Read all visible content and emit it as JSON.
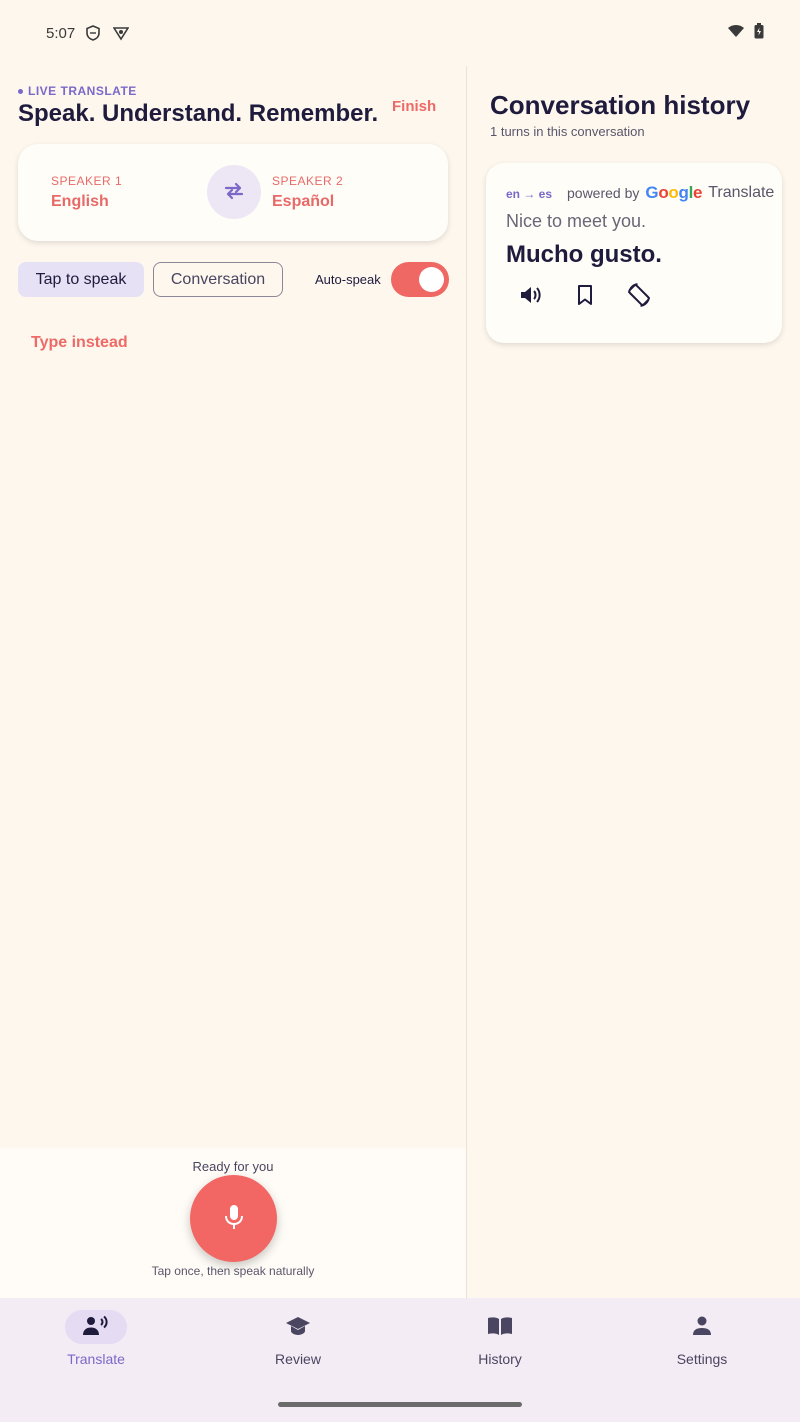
{
  "status_bar": {
    "time": "5:07"
  },
  "translate": {
    "eyebrow": "LIVE TRANSLATE",
    "headline": "Speak. Understand. Remember.",
    "finish_label": "Finish",
    "speaker1": {
      "label": "SPEAKER 1",
      "language": "English"
    },
    "speaker2": {
      "label": "SPEAKER 2",
      "language": "Español"
    },
    "modes": {
      "tap": "Tap to speak",
      "conversation": "Conversation"
    },
    "auto_speak_label": "Auto-speak",
    "auto_speak_on": true,
    "type_instead": "Type instead",
    "ready": "Ready for you",
    "hint": "Tap once, then speak naturally"
  },
  "history_panel": {
    "title": "Conversation history",
    "subtitle": "1 turns in this conversation",
    "turns": [
      {
        "pair": "en → es",
        "powered_by": "powered by",
        "brand": "Google",
        "brand_suffix": "Translate",
        "source": "Nice to meet you.",
        "target": "Mucho gusto."
      }
    ]
  },
  "nav": {
    "items": [
      {
        "label": "Translate",
        "icon": "translate-speaker-icon",
        "active": true
      },
      {
        "label": "Review",
        "icon": "graduation-cap-icon",
        "active": false
      },
      {
        "label": "History",
        "icon": "book-icon",
        "active": false
      },
      {
        "label": "Settings",
        "icon": "person-icon",
        "active": false
      }
    ]
  },
  "colors": {
    "accent_coral": "#f26663",
    "accent_purple": "#7b68c8",
    "background": "#fdf7ee",
    "ink": "#1f1b3d"
  }
}
